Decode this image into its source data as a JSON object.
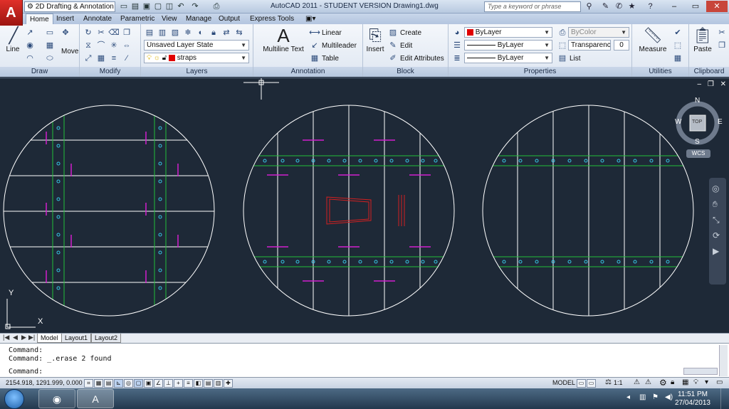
{
  "titlebar": {
    "workspace": "2D Drafting & Annotation",
    "title": "AutoCAD 2011 - STUDENT VERSION    Drawing1.dwg",
    "search_placeholder": "Type a keyword or phrase"
  },
  "tabs": [
    "Home",
    "Insert",
    "Annotate",
    "Parametric",
    "View",
    "Manage",
    "Output",
    "Express Tools"
  ],
  "panels": {
    "draw": "Draw",
    "modify": "Modify",
    "layers": "Layers",
    "annotation": "Annotation",
    "block": "Block",
    "properties": "Properties",
    "utilities": "Utilities",
    "clipboard": "Clipboard"
  },
  "ribbon": {
    "line": "Line",
    "move": "Move",
    "layer_state": "Unsaved Layer State",
    "current_layer": "straps",
    "multiline_text": "Multiline Text",
    "linear": "Linear",
    "multileader": "Multileader",
    "table": "Table",
    "insert": "Insert",
    "create": "Create",
    "edit": "Edit",
    "edit_attributes": "Edit Attributes",
    "color": "ByLayer",
    "linetype": "ByLayer",
    "lineweight": "ByLayer",
    "plot_style": "ByColor",
    "transparency_label": "Transparency",
    "transparency_value": "0",
    "list": "List",
    "measure": "Measure",
    "paste": "Paste"
  },
  "viewcube": {
    "north": "N",
    "south": "S",
    "east": "E",
    "west": "W",
    "face": "TOP",
    "wcs": "WCS"
  },
  "ucs": {
    "x": "X",
    "y": "Y"
  },
  "layout_tabs": [
    "Model",
    "Layout1",
    "Layout2"
  ],
  "command": {
    "line1": "Command:",
    "line2": "Command:  _.erase 2 found",
    "prompt": "Command:"
  },
  "status": {
    "coords": "2154.918, 1291.999, 0.000",
    "model": "MODEL",
    "scale": "1:1"
  },
  "clock": {
    "time": "11:51 PM",
    "date": "27/04/2013"
  },
  "colors": {
    "background": "#1e2937",
    "circle": "#ffffff",
    "strap": "#22c03a",
    "mark": "#d21fcf",
    "red": "#d42020",
    "hole": "#37c8e6"
  }
}
